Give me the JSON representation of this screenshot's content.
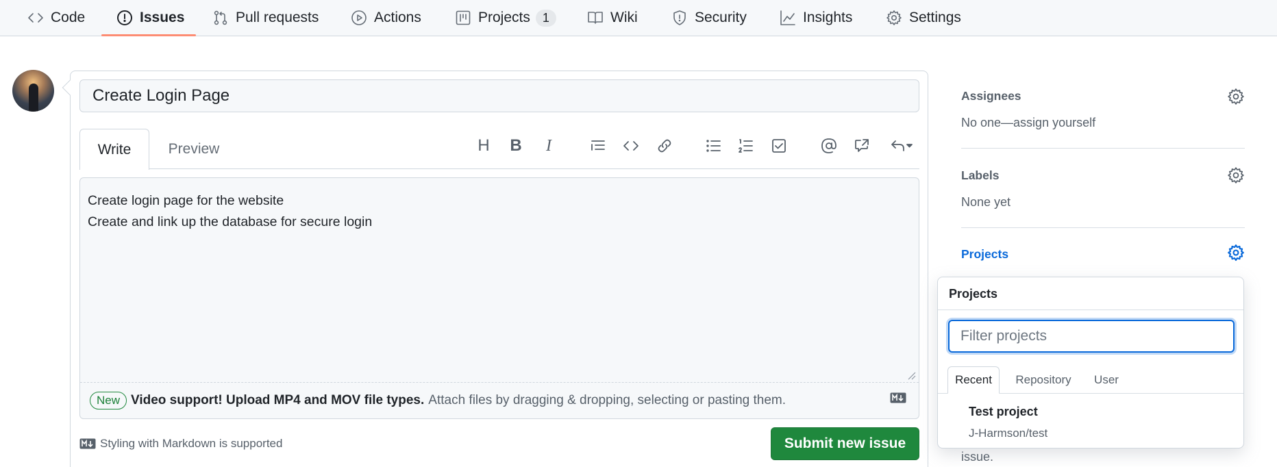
{
  "nav": {
    "tabs": [
      {
        "label": "Code",
        "icon": "code-icon"
      },
      {
        "label": "Issues",
        "icon": "issue-opened-icon",
        "active": true
      },
      {
        "label": "Pull requests",
        "icon": "git-pull-request-icon"
      },
      {
        "label": "Actions",
        "icon": "play-icon"
      },
      {
        "label": "Projects",
        "icon": "table-icon",
        "counter": "1"
      },
      {
        "label": "Wiki",
        "icon": "book-icon"
      },
      {
        "label": "Security",
        "icon": "shield-icon"
      },
      {
        "label": "Insights",
        "icon": "graph-icon"
      },
      {
        "label": "Settings",
        "icon": "gear-icon"
      }
    ],
    "active_underline_color": "#fd8c73"
  },
  "issue": {
    "title_value": "Create Login Page",
    "editor_tabs": {
      "write": "Write",
      "preview": "Preview"
    },
    "body_lines": [
      "Create login page for the website",
      "Create and link up the database for secure login"
    ],
    "attach": {
      "badge": "New",
      "strong": "Video support! Upload MP4 and MOV file types.",
      "text": "Attach files by dragging & dropping, selecting or pasting them."
    },
    "markdown_note": "Styling with Markdown is supported",
    "submit_label": "Submit new issue",
    "submit_color": "#1f883d"
  },
  "toolbar": {
    "heading": "H",
    "bold": "B",
    "italic": "I"
  },
  "sidebar": {
    "assignees": {
      "label": "Assignees",
      "value": "No one—assign yourself"
    },
    "labels": {
      "label": "Labels",
      "value": "None yet"
    },
    "projects": {
      "label": "Projects",
      "color": "#0969da"
    },
    "hidden_tail": "issue."
  },
  "projects_popover": {
    "title": "Projects",
    "filter_placeholder": "Filter projects",
    "tabs": [
      "Recent",
      "Repository",
      "User"
    ],
    "items": [
      {
        "name": "Test project",
        "repo": "J-Harmson/test"
      }
    ]
  }
}
